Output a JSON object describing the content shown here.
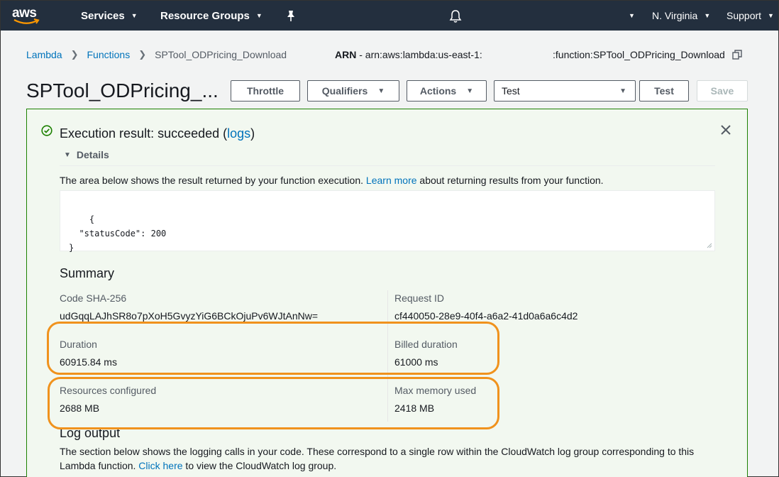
{
  "nav": {
    "logo": "aws",
    "services": "Services",
    "resource_groups": "Resource Groups",
    "region": "N. Virginia",
    "support": "Support",
    "icons": [
      "pin-icon",
      "bell-icon"
    ]
  },
  "breadcrumb": {
    "items": [
      "Lambda",
      "Functions",
      "SPTool_ODPricing_Download"
    ]
  },
  "arn": {
    "label": "ARN",
    "prefix": " - arn:aws:lambda:us-east-1:",
    "suffix": ":function:SPTool_ODPricing_Download"
  },
  "header": {
    "title": "SPTool_ODPricing_...",
    "throttle": "Throttle",
    "qualifiers": "Qualifiers",
    "actions": "Actions",
    "test_event": "Test",
    "test": "Test",
    "save": "Save"
  },
  "result": {
    "title_prefix": "Execution result: succeeded (",
    "logs_link": "logs",
    "title_suffix": ")",
    "details": "Details",
    "desc_prefix": "The area below shows the result returned by your function execution. ",
    "learn_more": "Learn more",
    "desc_suffix": " about returning results from your function.",
    "output": "{\n  \"statusCode\": 200\n}"
  },
  "summary": {
    "heading": "Summary",
    "code_sha_label": "Code SHA-256",
    "code_sha_value": "udGqqLAJhSR8o7pXoH5GvyzYiG6BCkOjuPv6WJtAnNw=",
    "request_id_label": "Request ID",
    "request_id_value": "cf440050-28e9-40f4-a6a2-41d0a6a6c4d2",
    "duration_label": "Duration",
    "duration_value": "60915.84 ms",
    "billed_label": "Billed duration",
    "billed_value": "61000 ms",
    "resources_label": "Resources configured",
    "resources_value": "2688 MB",
    "max_memory_label": "Max memory used",
    "max_memory_value": "2418 MB"
  },
  "log": {
    "heading": "Log output",
    "desc_prefix": "The section below shows the logging calls in your code. These correspond to a single row within the CloudWatch log group corresponding to this Lambda function. ",
    "click_here": "Click here",
    "desc_suffix": " to view the CloudWatch log group."
  },
  "colors": {
    "nav_bg": "#232f3e",
    "link": "#0073bb",
    "success": "#1d8102",
    "highlight": "#f0921d"
  }
}
